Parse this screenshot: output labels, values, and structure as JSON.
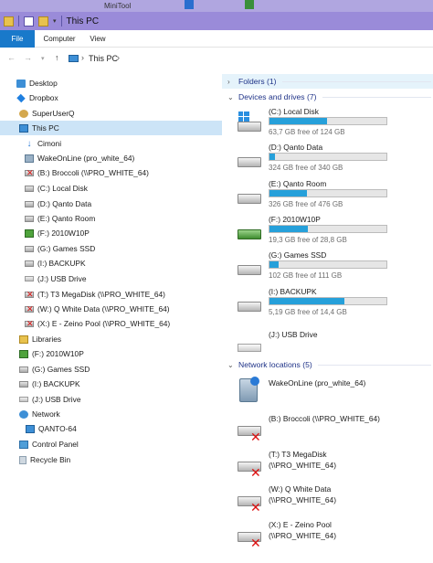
{
  "titlebar": {
    "title": "This PC",
    "taskbar_label": "MiniTool"
  },
  "ribbon": {
    "tabs": [
      "File",
      "Computer",
      "View"
    ]
  },
  "address": {
    "path": "This PC"
  },
  "nav_pane": {
    "items": [
      {
        "label": "Desktop",
        "icon": "desktop-icon"
      },
      {
        "label": "Dropbox",
        "icon": "dropbox-icon"
      },
      {
        "label": "SuperUserQ",
        "icon": "user-folder-icon"
      },
      {
        "label": "This PC",
        "icon": "computer-icon"
      },
      {
        "label": "Cimoni",
        "icon": "download-icon"
      },
      {
        "label": "WakeOnLine (pro_white_64)",
        "icon": "network-app-icon"
      },
      {
        "label": "(B:) Broccoli (\\\\PRO_WHITE_64)",
        "icon": "disconnected-drive-icon"
      },
      {
        "label": "(C:) Local Disk",
        "icon": "drive-icon"
      },
      {
        "label": "(D:) Qanto Data",
        "icon": "drive-icon"
      },
      {
        "label": "(E:) Qanto Room",
        "icon": "drive-icon"
      },
      {
        "label": "(F:) 2010W10P",
        "icon": "green-drive-icon"
      },
      {
        "label": "(G:) Games  SSD",
        "icon": "drive-icon"
      },
      {
        "label": "(I:) BACKUPK",
        "icon": "drive-icon"
      },
      {
        "label": "(J:) USB Drive",
        "icon": "usb-drive-icon"
      },
      {
        "label": "(T:) T3 MegaDisk (\\\\PRO_WHITE_64)",
        "icon": "disconnected-drive-icon"
      },
      {
        "label": "(W:) Q White Data (\\\\PRO_WHITE_64)",
        "icon": "disconnected-drive-icon"
      },
      {
        "label": "(X:) E -  Zeino Pool (\\\\PRO_WHITE_64)",
        "icon": "disconnected-drive-icon"
      },
      {
        "label": "Libraries",
        "icon": "libraries-icon"
      },
      {
        "label": "(F:) 2010W10P",
        "icon": "green-drive-icon"
      },
      {
        "label": "(G:) Games  SSD",
        "icon": "drive-icon"
      },
      {
        "label": "(I:) BACKUPK",
        "icon": "drive-icon"
      },
      {
        "label": "(J:) USB Drive",
        "icon": "usb-drive-icon"
      },
      {
        "label": "Network",
        "icon": "network-icon"
      },
      {
        "label": "QANTO-64",
        "icon": "computer-icon"
      },
      {
        "label": "Control Panel",
        "icon": "control-panel-icon"
      },
      {
        "label": "Recycle Bin",
        "icon": "recycle-bin-icon"
      }
    ]
  },
  "content": {
    "folders_header": "Folders (1)",
    "devices_header": "Devices and drives (7)",
    "network_header": "Network locations (5)",
    "drives": [
      {
        "name": "(C:) Local Disk",
        "free": "63,7 GB free of 124 GB",
        "used_fraction": 0.49,
        "icon": "windows-drive-icon"
      },
      {
        "name": "(D:) Qanto Data",
        "free": "324 GB free of 340 GB",
        "used_fraction": 0.05,
        "icon": "drive-icon"
      },
      {
        "name": "(E:) Qanto Room",
        "free": "326 GB free of 476 GB",
        "used_fraction": 0.32,
        "icon": "drive-icon"
      },
      {
        "name": "(F:) 2010W10P",
        "free": "19,3 GB free of 28,8 GB",
        "used_fraction": 0.33,
        "icon": "green-drive-icon"
      },
      {
        "name": "(G:) Games  SSD",
        "free": "102 GB free of 111 GB",
        "used_fraction": 0.08,
        "icon": "drive-icon"
      },
      {
        "name": "(I:) BACKUPK",
        "free": "5,19 GB free of 14,4 GB",
        "used_fraction": 0.64,
        "icon": "drive-icon"
      },
      {
        "name": "(J:) USB Drive",
        "icon": "usb-drive-icon"
      }
    ],
    "network": [
      {
        "name": "WakeOnLine (pro_white_64)",
        "icon": "network-app-icon"
      },
      {
        "name": "(B:) Broccoli (\\\\PRO_WHITE_64)",
        "icon": "disconnected-drive-icon"
      },
      {
        "name": "(T:) T3 MegaDisk",
        "name2": "(\\\\PRO_WHITE_64)",
        "icon": "disconnected-drive-icon"
      },
      {
        "name": "(W:) Q White Data",
        "name2": "(\\\\PRO_WHITE_64)",
        "icon": "disconnected-drive-icon"
      },
      {
        "name": "(X:) E -  Zeino Pool",
        "name2": "(\\\\PRO_WHITE_64)",
        "icon": "disconnected-drive-icon"
      }
    ]
  },
  "colors": {
    "accent": "#1979ca",
    "titlebar": "#9a8bd9",
    "selection": "#cce4f7",
    "usage_bar": "#26a0da",
    "group_header_text": "#1e3287"
  }
}
